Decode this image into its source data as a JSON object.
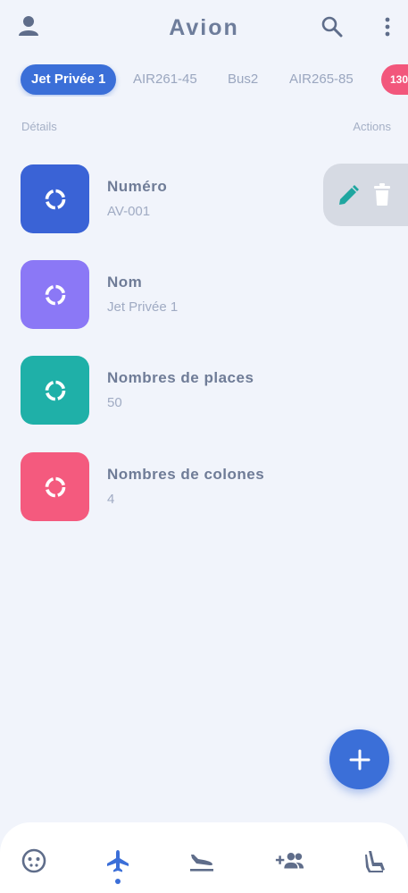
{
  "header": {
    "title": "Avion"
  },
  "tabs": [
    {
      "label": "Jet Privée 1",
      "active": true
    },
    {
      "label": "AIR261-45"
    },
    {
      "label": "Bus2"
    },
    {
      "label": "AIR265-85"
    },
    {
      "label": "130"
    }
  ],
  "columns": {
    "details": "Détails",
    "actions": "Actions"
  },
  "rows": [
    {
      "label": "Numéro",
      "value": "AV-001",
      "color": "#3a63d6"
    },
    {
      "label": "Nom",
      "value": "Jet Privée 1",
      "color": "#8b78f6"
    },
    {
      "label": "Nombres de places",
      "value": "50",
      "color": "#1fb0a8"
    },
    {
      "label": "Nombres de colones",
      "value": "4",
      "color": "#f45a7e"
    }
  ],
  "colors": {
    "accent": "#3b6fd8",
    "edit": "#1fa6a0",
    "nav_icon": "#6b7a99",
    "background": "#f1f4fb"
  },
  "icons": {
    "header": [
      "user-icon",
      "search-icon",
      "more-vertical-icon"
    ],
    "actions": [
      "pencil-icon",
      "trash-icon"
    ],
    "fab": "plus-icon",
    "nav": [
      "face-icon",
      "airplane-icon",
      "flight-land-icon",
      "add-group-icon",
      "seat-icon"
    ]
  },
  "bottom_nav": {
    "active_index": 1
  }
}
